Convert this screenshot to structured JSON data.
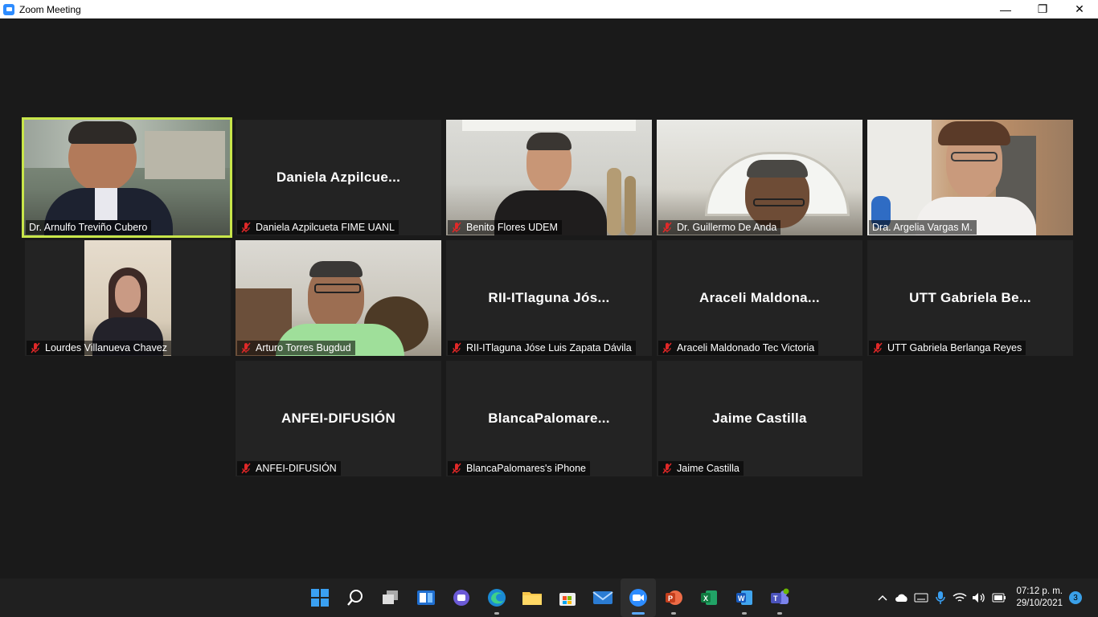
{
  "window": {
    "title": "Zoom Meeting",
    "controls": {
      "minimize": "—",
      "maximize": "❐",
      "close": "✕"
    }
  },
  "participants": [
    {
      "label": "Dr. Arnulfo Treviño Cubero",
      "display": "",
      "muted": false,
      "video": true
    },
    {
      "label": "Daniela Azpilcueta FIME UANL",
      "display": "Daniela  Azpilcue...",
      "muted": true,
      "video": false
    },
    {
      "label": "Benito Flores UDEM",
      "display": "",
      "muted": true,
      "video": true
    },
    {
      "label": "Dr. Guillermo De Anda",
      "display": "",
      "muted": true,
      "video": true
    },
    {
      "label": "Dra. Argelia Vargas M.",
      "display": "",
      "muted": false,
      "video": true
    },
    {
      "label": "Lourdes Villanueva Chavez",
      "display": "",
      "muted": true,
      "video": true
    },
    {
      "label": "Arturo Torres Bugdud",
      "display": "",
      "muted": true,
      "video": true
    },
    {
      "label": "RII-ITlaguna Jóse Luis Zapata Dávila",
      "display": "RII-ITlaguna  Jós...",
      "muted": true,
      "video": false
    },
    {
      "label": "Araceli Maldonado Tec Victoria",
      "display": "Araceli  Maldona...",
      "muted": true,
      "video": false
    },
    {
      "label": "UTT Gabriela Berlanga Reyes",
      "display": "UTT  Gabriela  Be...",
      "muted": true,
      "video": false
    },
    {
      "label": "ANFEI-DIFUSIÓN",
      "display": "ANFEI-DIFUSIÓN",
      "muted": true,
      "video": false
    },
    {
      "label": "BlancaPalomares's iPhone",
      "display": "BlancaPalomare...",
      "muted": true,
      "video": false
    },
    {
      "label": "Jaime Castilla",
      "display": "Jaime Castilla",
      "muted": true,
      "video": false
    }
  ],
  "taskbar": {
    "apps": [
      "start-icon",
      "search-icon",
      "task-view-icon",
      "widgets-icon",
      "teams-chat-icon",
      "edge-icon",
      "file-explorer-icon",
      "store-icon",
      "mail-icon",
      "zoom-icon",
      "powerpoint-icon",
      "excel-icon",
      "word-icon",
      "teams-icon"
    ],
    "tray": {
      "time": "07:12 p. m.",
      "date": "29/10/2021",
      "notifications": "3"
    }
  },
  "colors": {
    "active_speaker": "#c8e64a",
    "muted": "#e02828",
    "zoom_blue": "#2d8cff"
  }
}
